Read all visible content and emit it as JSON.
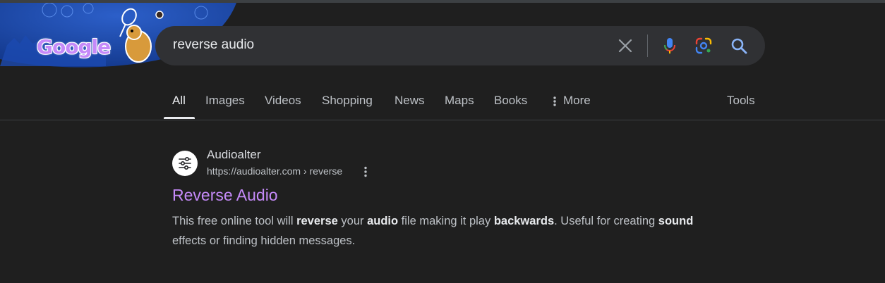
{
  "search": {
    "query": "reverse audio",
    "clear_icon": "close-icon",
    "mic_icon": "microphone-icon",
    "lens_icon": "google-lens-icon",
    "search_icon": "search-icon"
  },
  "doodle": {
    "wordmark": "Google"
  },
  "tabs": [
    {
      "label": "All",
      "active": true
    },
    {
      "label": "Images"
    },
    {
      "label": "Videos"
    },
    {
      "label": "Shopping"
    },
    {
      "label": "News"
    },
    {
      "label": "Maps"
    },
    {
      "label": "Books"
    },
    {
      "label": "More",
      "icon": "more-vert-icon"
    }
  ],
  "tools_label": "Tools",
  "result": {
    "site_name": "Audioalter",
    "url": "https://audioalter.com › reverse",
    "title": "Reverse Audio",
    "snippet_parts": [
      {
        "text": "This free online tool will "
      },
      {
        "text": "reverse",
        "bold": true
      },
      {
        "text": " your "
      },
      {
        "text": "audio",
        "bold": true
      },
      {
        "text": " file making it play "
      },
      {
        "text": "backwards",
        "bold": true
      },
      {
        "text": ". Useful for creating "
      },
      {
        "text": "sound",
        "bold": true
      },
      {
        "text": " effects or finding hidden messages."
      }
    ],
    "favicon_icon": "sliders-icon",
    "menu_icon": "more-vert-icon"
  },
  "colors": {
    "background": "#1f1f1f",
    "search_bg": "#303134",
    "visited_link": "#c58af9",
    "text_secondary": "#bdc1c6"
  }
}
